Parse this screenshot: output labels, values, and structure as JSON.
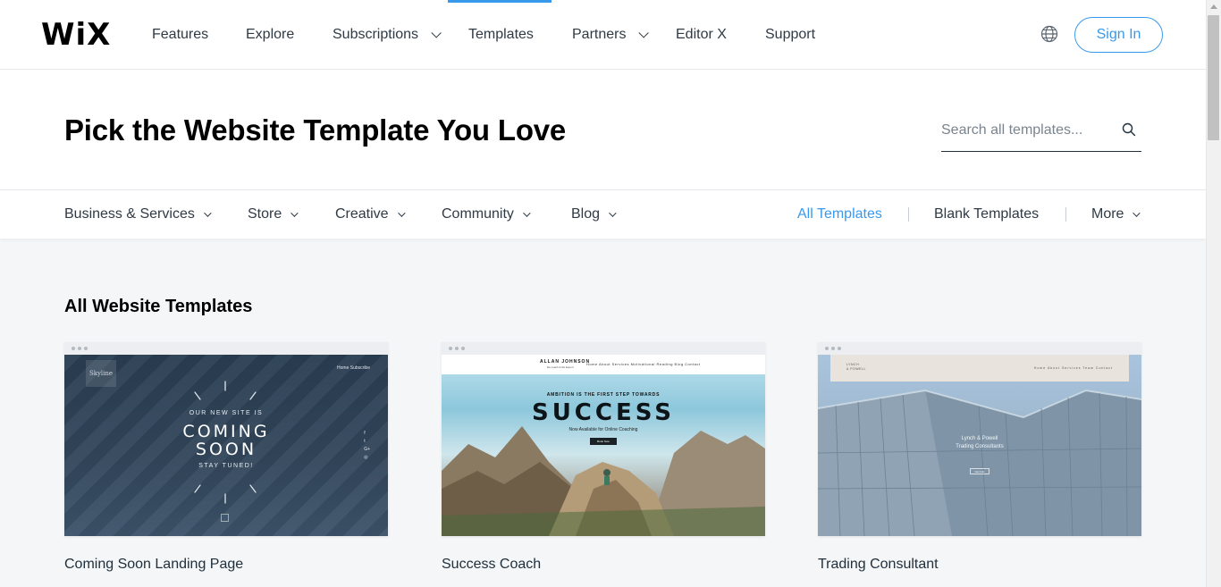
{
  "brand": {
    "logo": "WiX",
    "accent": "#3899ec"
  },
  "nav": {
    "items": [
      {
        "label": "Features",
        "dropdown": false
      },
      {
        "label": "Explore",
        "dropdown": false
      },
      {
        "label": "Subscriptions",
        "dropdown": true
      },
      {
        "label": "Templates",
        "dropdown": false,
        "active": true
      },
      {
        "label": "Partners",
        "dropdown": true
      },
      {
        "label": "Editor X",
        "dropdown": false
      },
      {
        "label": "Support",
        "dropdown": false
      }
    ],
    "language_icon": "globe-icon",
    "signin_label": "Sign In"
  },
  "hero": {
    "title": "Pick the Website Template You Love",
    "search_placeholder": "Search all templates...",
    "search_icon": "search-icon"
  },
  "categories": {
    "left": [
      {
        "label": "Business & Services"
      },
      {
        "label": "Store"
      },
      {
        "label": "Creative"
      },
      {
        "label": "Community"
      },
      {
        "label": "Blog"
      }
    ],
    "right": [
      {
        "label": "All Templates",
        "active": true
      },
      {
        "label": "Blank Templates"
      },
      {
        "label": "More",
        "dropdown": true
      }
    ]
  },
  "section": {
    "title": "All Website Templates",
    "cards": [
      {
        "title": "Coming Soon Landing Page",
        "thumb": {
          "badge": "Skyline",
          "nav": "Home   Subscribe",
          "small_top": "OUR NEW SITE IS",
          "big_1": "COMING",
          "big_2": "SOON",
          "small_bottom": "STAY TUNED!",
          "social": "f\nt\nG+\n◎"
        }
      },
      {
        "title": "Success Coach",
        "thumb": {
          "name": "ALLAN JOHNSON",
          "sub": "life coach & life Expert",
          "links": "Home   About   Services   Motivational Reading   Blog   Contact",
          "eyebrow": "AMBITION IS THE FIRST STEP TOWARDS",
          "headline": "SUCCESS",
          "tagline": "Now Available for Online Coaching",
          "button": "Book Now"
        }
      },
      {
        "title": "Trading Consultant",
        "thumb": {
          "logo": "LYNCH\n& POWELL",
          "links": "Home   About   Services   Team   Contact",
          "caption_1": "Lynch & Powell",
          "caption_2": "Trading Consultants",
          "button": "Get Info"
        }
      }
    ]
  }
}
